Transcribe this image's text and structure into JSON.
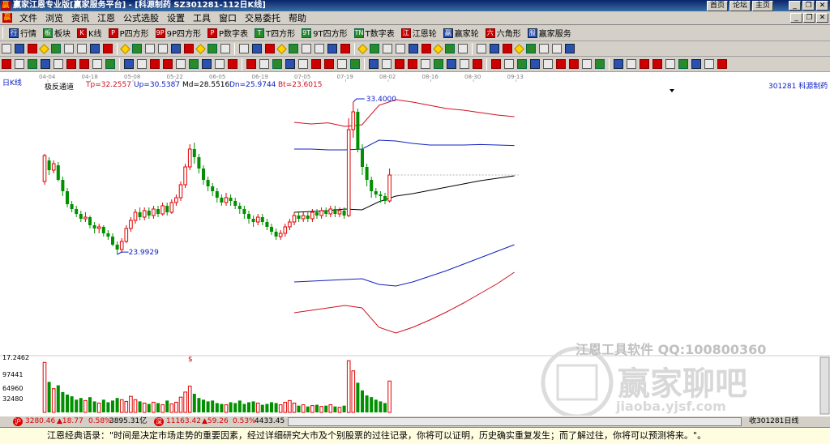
{
  "window": {
    "icon_text": "赢",
    "title": "赢家江恩专业版[赢家服务平台] - [科源制药  SZ301281-112日K线]",
    "links": [
      "首页",
      "论坛",
      "主页"
    ]
  },
  "menu": [
    "文件",
    "浏览",
    "资讯",
    "江恩",
    "公式选股",
    "设置",
    "工具",
    "窗口",
    "交易委托",
    "帮助"
  ],
  "toolbar1": [
    {
      "icon": "行",
      "label": "行情"
    },
    {
      "icon": "板",
      "label": "板块"
    },
    {
      "icon": "K",
      "label": "K线"
    },
    {
      "icon": "P",
      "label": "P四方形"
    },
    {
      "icon": "9P",
      "label": "9P四方形"
    },
    {
      "icon": "P",
      "label": "P数字表"
    },
    {
      "icon": "T",
      "label": "T四方形"
    },
    {
      "icon": "9T",
      "label": "9T四方形"
    },
    {
      "icon": "TN",
      "label": "T数字表"
    },
    {
      "icon": "江",
      "label": "江恩轮"
    },
    {
      "icon": "赢",
      "label": "赢家轮"
    },
    {
      "icon": "六",
      "label": "六角形"
    },
    {
      "icon": "服",
      "label": "赢家服务"
    }
  ],
  "header": {
    "period": "日K线",
    "indicator": "极反通道",
    "tp": "Tp=32.2557",
    "up": "Up=30.5387",
    "md": "Md=28.5516",
    "dn": "Dn=25.9744",
    "bt": "Bt=23.6015",
    "stock": "301281  科源制药"
  },
  "chart_data": {
    "type": "candlestick",
    "x_tick_labels": [
      "04-04",
      "04-18",
      "05-08",
      "05-22",
      "06-05",
      "06-19",
      "07-05",
      "07-19",
      "08-02",
      "08-16",
      "08-30",
      "09-13"
    ],
    "annotations": [
      "33.4000",
      "23.9929"
    ],
    "price_min": 23.9929,
    "price_max": 33.4,
    "candles": [
      [
        28.5,
        30.1,
        28.3,
        30.2
      ],
      [
        29.8,
        29.2,
        28.9,
        30.0
      ],
      [
        29.2,
        29.6,
        29.0,
        29.8
      ],
      [
        29.5,
        28.6,
        28.5,
        29.7
      ],
      [
        28.6,
        27.9,
        27.6,
        28.8
      ],
      [
        27.9,
        27.1,
        26.9,
        28.1
      ],
      [
        27.1,
        26.8,
        26.6,
        27.3
      ],
      [
        26.8,
        26.5,
        26.3,
        27.0
      ],
      [
        26.5,
        26.2,
        26.0,
        26.7
      ],
      [
        26.2,
        26.3,
        26.0,
        26.6
      ],
      [
        26.3,
        25.8,
        25.6,
        26.4
      ],
      [
        25.8,
        25.6,
        25.3,
        26.0
      ],
      [
        25.6,
        25.7,
        25.3,
        25.9
      ],
      [
        25.7,
        25.3,
        25.1,
        25.8
      ],
      [
        25.3,
        25.1,
        24.9,
        25.5
      ],
      [
        25.1,
        24.6,
        24.5,
        25.3
      ],
      [
        24.6,
        24.3,
        24.0,
        24.8
      ],
      [
        24.3,
        24.8,
        24.1,
        25.0
      ],
      [
        24.8,
        25.6,
        24.7,
        25.8
      ],
      [
        25.6,
        26.1,
        25.4,
        26.3
      ],
      [
        26.1,
        26.6,
        25.9,
        26.8
      ],
      [
        26.6,
        26.3,
        26.1,
        26.9
      ],
      [
        26.3,
        26.7,
        26.1,
        26.9
      ],
      [
        26.7,
        26.4,
        26.2,
        26.9
      ],
      [
        26.4,
        26.8,
        26.2,
        27.0
      ],
      [
        26.8,
        26.5,
        26.3,
        27.0
      ],
      [
        26.5,
        27.0,
        26.4,
        27.2
      ],
      [
        27.0,
        26.6,
        26.4,
        27.2
      ],
      [
        26.6,
        27.2,
        26.5,
        27.4
      ],
      [
        27.2,
        27.5,
        27.0,
        27.7
      ],
      [
        27.5,
        28.3,
        27.3,
        28.5
      ],
      [
        28.3,
        29.4,
        28.1,
        29.6
      ],
      [
        29.4,
        30.5,
        29.2,
        30.8
      ],
      [
        30.5,
        30.0,
        29.6,
        30.9
      ],
      [
        30.0,
        29.3,
        29.0,
        30.2
      ],
      [
        29.3,
        28.6,
        28.3,
        29.5
      ],
      [
        28.6,
        28.2,
        27.9,
        28.8
      ],
      [
        28.2,
        27.9,
        27.6,
        28.4
      ],
      [
        27.9,
        27.5,
        27.2,
        28.1
      ],
      [
        27.5,
        27.2,
        27.0,
        27.7
      ],
      [
        27.2,
        27.5,
        27.0,
        27.8
      ],
      [
        27.5,
        27.3,
        27.0,
        27.7
      ],
      [
        27.3,
        27.0,
        26.8,
        27.5
      ],
      [
        27.0,
        26.8,
        26.5,
        27.2
      ],
      [
        26.8,
        26.5,
        26.2,
        27.0
      ],
      [
        26.5,
        26.2,
        25.9,
        26.7
      ],
      [
        26.2,
        26.0,
        25.7,
        26.4
      ],
      [
        26.0,
        26.3,
        25.8,
        26.5
      ],
      [
        26.3,
        26.0,
        25.8,
        26.5
      ],
      [
        26.0,
        25.7,
        25.5,
        26.2
      ],
      [
        25.7,
        25.4,
        25.2,
        25.9
      ],
      [
        25.4,
        25.1,
        24.9,
        25.6
      ],
      [
        25.1,
        25.3,
        24.9,
        25.5
      ],
      [
        25.3,
        25.7,
        25.1,
        25.9
      ],
      [
        25.7,
        26.0,
        25.5,
        26.2
      ],
      [
        26.0,
        26.4,
        25.8,
        26.6
      ],
      [
        26.4,
        26.2,
        26.0,
        26.6
      ],
      [
        26.2,
        26.4,
        26.0,
        26.6
      ],
      [
        26.4,
        26.2,
        26.0,
        26.6
      ],
      [
        26.2,
        26.6,
        26.0,
        26.8
      ],
      [
        26.6,
        26.4,
        26.2,
        26.8
      ],
      [
        26.4,
        26.7,
        26.2,
        26.9
      ],
      [
        26.7,
        26.5,
        26.3,
        26.9
      ],
      [
        26.5,
        26.8,
        26.3,
        27.0
      ],
      [
        26.8,
        26.5,
        26.3,
        27.0
      ],
      [
        26.5,
        26.7,
        26.3,
        26.9
      ],
      [
        26.7,
        26.4,
        26.2,
        26.9
      ],
      [
        26.4,
        31.7,
        26.3,
        32.4
      ],
      [
        31.7,
        32.8,
        31.2,
        33.4
      ],
      [
        32.8,
        30.5,
        30.3,
        33.0
      ],
      [
        30.5,
        29.4,
        28.9,
        30.8
      ],
      [
        29.4,
        28.6,
        28.2,
        29.6
      ],
      [
        28.6,
        27.9,
        27.5,
        28.8
      ],
      [
        27.9,
        27.7,
        27.5,
        28.1
      ],
      [
        27.7,
        27.6,
        27.2,
        27.9
      ],
      [
        27.6,
        27.3,
        27.1,
        27.8
      ],
      [
        27.3,
        28.9,
        27.2,
        29.3
      ]
    ],
    "channel_x_start": 55,
    "tp_line": [
      32.15,
      32.05,
      32.12,
      31.9,
      32.0,
      33.2,
      33.55,
      33.4,
      33.2,
      33.0,
      32.9,
      32.75,
      32.6,
      32.5
    ],
    "up_line": [
      30.5,
      30.5,
      30.45,
      30.45,
      30.5,
      31.05,
      31.0,
      30.85,
      30.75,
      30.75,
      30.75,
      30.78,
      30.75,
      30.72
    ],
    "md_line": [
      26.6,
      26.65,
      26.7,
      26.8,
      26.75,
      27.25,
      27.6,
      27.75,
      27.95,
      28.15,
      28.35,
      28.55,
      28.7,
      28.85
    ],
    "dn_line": [
      22.3,
      22.35,
      22.4,
      22.45,
      22.5,
      22.15,
      22.05,
      22.3,
      22.65,
      23.0,
      23.4,
      23.8,
      24.2,
      24.6
    ],
    "bt_line": [
      20.4,
      20.55,
      20.7,
      20.85,
      20.7,
      19.5,
      19.15,
      19.5,
      19.95,
      20.45,
      21.0,
      21.6,
      22.2,
      22.9
    ],
    "last_price_guide": 28.9,
    "volume_axis_labels": [
      "17.2462",
      "97441",
      "64960",
      "32480"
    ],
    "volume_max": 130000,
    "volumes": [
      118000,
      72000,
      56000,
      64000,
      48000,
      42000,
      38000,
      30000,
      34000,
      28000,
      36000,
      26000,
      22000,
      30000,
      24000,
      28000,
      34000,
      30000,
      26000,
      38000,
      30000,
      26000,
      22000,
      20000,
      24000,
      22000,
      18000,
      28000,
      20000,
      24000,
      36000,
      48000,
      62000,
      44000,
      34000,
      30000,
      26000,
      28000,
      22000,
      20000,
      18000,
      24000,
      22000,
      28000,
      20000,
      24000,
      26000,
      22000,
      18000,
      20000,
      24000,
      22000,
      18000,
      24000,
      28000,
      22000,
      16000,
      18000,
      14000,
      16000,
      18000,
      14000,
      16000,
      18000,
      14000,
      12000,
      16000,
      122000,
      98000,
      70000,
      52000,
      40000,
      36000,
      30000,
      26000,
      22000,
      74000
    ]
  },
  "colors": {
    "up": "#e00000",
    "down": "#009000",
    "tp": "#d01020",
    "up_line": "#1020c0",
    "md": "#000000",
    "dn": "#1020c0",
    "bt": "#d01020"
  },
  "status": {
    "sh_badge": "沪",
    "sh_index": "3280.46",
    "sh_change": "▲18.77",
    "sh_pct": "0.58%",
    "sh_amount": "3895.31亿",
    "sz_badge": "深",
    "sz_index": "11163.42",
    "sz_change": "▲59.26",
    "sz_pct": "0.53%",
    "sz_amount": "4433.45",
    "right_text": "收301281日线"
  },
  "quote": "江恩经典语录：\"时间是决定市场走势的重要因素，经过详细研究大市及个别股票的过往记录，你将可以证明，历史确实重复发生；而了解过往，你将可以预测将来。\"。",
  "watermark": {
    "company": "江恩工具软件 QQ:100800360",
    "brand": "赢家聊吧",
    "url": "jiaoba.yjsf.com"
  }
}
